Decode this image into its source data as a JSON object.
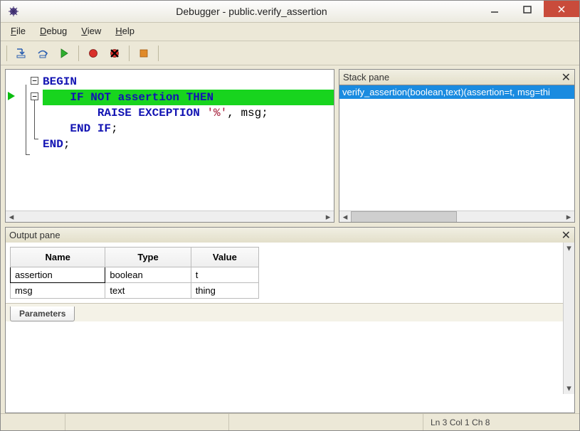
{
  "title": "Debugger - public.verify_assertion",
  "menubar": [
    {
      "label": "File",
      "u": 0
    },
    {
      "label": "Debug",
      "u": 0
    },
    {
      "label": "View",
      "u": 0
    },
    {
      "label": "Help",
      "u": 0
    }
  ],
  "toolbar": {
    "step_into": "step-into",
    "step_over": "step-over",
    "continue": "continue",
    "breakpoint": "toggle-breakpoint",
    "clear_bp": "clear-breakpoints",
    "stop": "stop"
  },
  "code": {
    "lines": [
      {
        "text": "BEGIN",
        "cls": "kw",
        "indent": 0
      },
      {
        "text": "    IF NOT assertion THEN",
        "cls": "kw",
        "current": true,
        "indent": 1
      },
      {
        "text": "        RAISE EXCEPTION ",
        "after_str": "'%'",
        "after2": ", msg;",
        "cls": "kw",
        "indent": 2
      },
      {
        "text": "    END IF",
        "after2": ";",
        "cls": "kw",
        "indent": 1
      },
      {
        "text": "END",
        "after2": ";",
        "cls": "kw",
        "indent": 0
      }
    ]
  },
  "stack": {
    "header": "Stack pane",
    "rows": [
      "verify_assertion(boolean,text)(assertion=t, msg=thi"
    ]
  },
  "output": {
    "header": "Output pane",
    "columns": [
      "Name",
      "Type",
      "Value"
    ],
    "rows": [
      {
        "Name": "assertion",
        "Type": "boolean",
        "Value": "t",
        "sel": true
      },
      {
        "Name": "msg",
        "Type": "text",
        "Value": "thing"
      }
    ],
    "tab": "Parameters"
  },
  "status": {
    "pos": "Ln 3 Col 1 Ch 8"
  }
}
